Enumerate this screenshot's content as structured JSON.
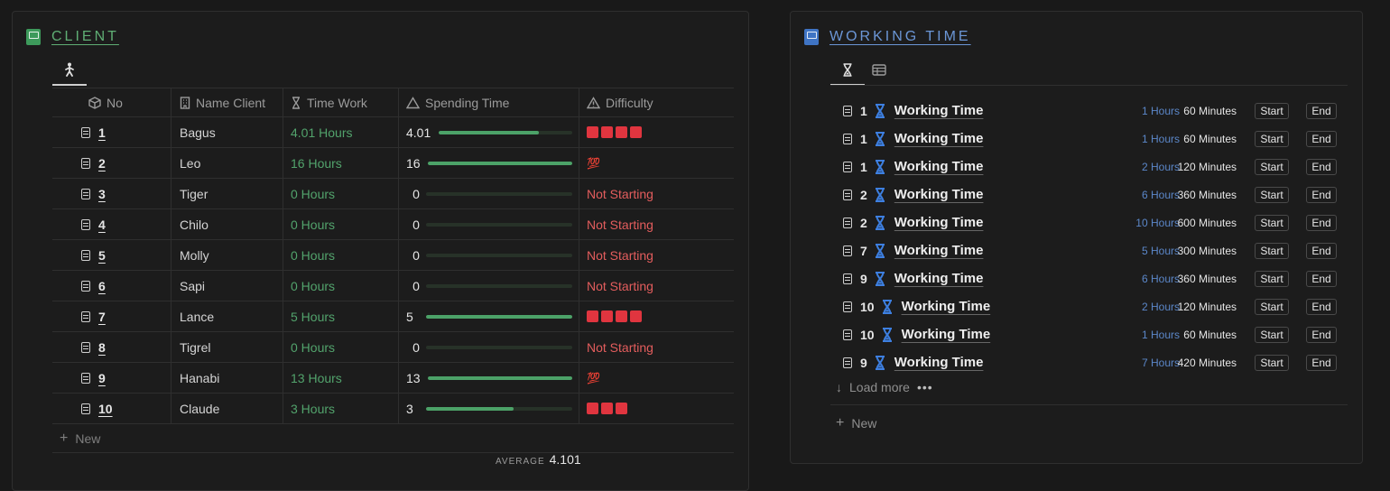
{
  "client": {
    "title": "CLIENT",
    "color": "#4ca268",
    "columns": {
      "no": "No",
      "name": "Name Client",
      "time": "Time Work",
      "spend": "Spending Time",
      "difficulty": "Difficulty"
    },
    "rows": [
      {
        "no": "1",
        "name": "Bagus",
        "time": "4.01 Hours",
        "spend": "4.01",
        "fill": 0.75,
        "difficulty": "squares",
        "squares": 4
      },
      {
        "no": "2",
        "name": "Leo",
        "time": "16 Hours",
        "spend": "16",
        "fill": 1.0,
        "difficulty": "hundred",
        "hundred_text": "💯"
      },
      {
        "no": "3",
        "name": "Tiger",
        "time": "0 Hours",
        "spend": "0",
        "fill": 0,
        "difficulty": "text",
        "difficulty_text": "Not Starting"
      },
      {
        "no": "4",
        "name": "Chilo",
        "time": "0 Hours",
        "spend": "0",
        "fill": 0,
        "difficulty": "text",
        "difficulty_text": "Not Starting"
      },
      {
        "no": "5",
        "name": "Molly",
        "time": "0 Hours",
        "spend": "0",
        "fill": 0,
        "difficulty": "text",
        "difficulty_text": "Not Starting"
      },
      {
        "no": "6",
        "name": "Sapi",
        "time": "0 Hours",
        "spend": "0",
        "fill": 0,
        "difficulty": "text",
        "difficulty_text": "Not Starting"
      },
      {
        "no": "7",
        "name": "Lance",
        "time": "5 Hours",
        "spend": "5",
        "fill": 1.0,
        "difficulty": "squares",
        "squares": 4
      },
      {
        "no": "8",
        "name": "Tigrel",
        "time": "0 Hours",
        "spend": "0",
        "fill": 0,
        "difficulty": "text",
        "difficulty_text": "Not Starting"
      },
      {
        "no": "9",
        "name": "Hanabi",
        "time": "13 Hours",
        "spend": "13",
        "fill": 1.0,
        "difficulty": "hundred",
        "hundred_text": "💯"
      },
      {
        "no": "10",
        "name": "Claude",
        "time": "3 Hours",
        "spend": "3",
        "fill": 0.6,
        "difficulty": "squares",
        "squares": 3
      }
    ],
    "new_label": "New",
    "average_label": "AVERAGE",
    "average_value": "4.101"
  },
  "working": {
    "title": "WORKING TIME",
    "color": "#5b87c9",
    "items": [
      {
        "num": "1",
        "title": "Working Time",
        "hours": "1 Hours",
        "minutes": "60 Minutes"
      },
      {
        "num": "1",
        "title": "Working Time",
        "hours": "1 Hours",
        "minutes": "60 Minutes"
      },
      {
        "num": "1",
        "title": "Working Time",
        "hours": "2 Hours",
        "minutes": "120 Minutes"
      },
      {
        "num": "2",
        "title": "Working Time",
        "hours": "6 Hours",
        "minutes": "360 Minutes"
      },
      {
        "num": "2",
        "title": "Working Time",
        "hours": "10 Hours",
        "minutes": "600 Minutes"
      },
      {
        "num": "7",
        "title": "Working Time",
        "hours": "5 Hours",
        "minutes": "300 Minutes"
      },
      {
        "num": "9",
        "title": "Working Time",
        "hours": "6 Hours",
        "minutes": "360 Minutes"
      },
      {
        "num": "10",
        "title": "Working Time",
        "hours": "2 Hours",
        "minutes": "120 Minutes"
      },
      {
        "num": "10",
        "title": "Working Time",
        "hours": "1 Hours",
        "minutes": "60 Minutes"
      },
      {
        "num": "9",
        "title": "Working Time",
        "hours": "7 Hours",
        "minutes": "420 Minutes"
      }
    ],
    "start_label": "Start",
    "end_label": "End",
    "load_more": "Load more",
    "new_label": "New"
  },
  "icons": {
    "book": "book-icon",
    "note": "note-icon",
    "hourglass": "hourglass-icon",
    "table": "table-icon",
    "figure": "walking-figure-icon"
  }
}
